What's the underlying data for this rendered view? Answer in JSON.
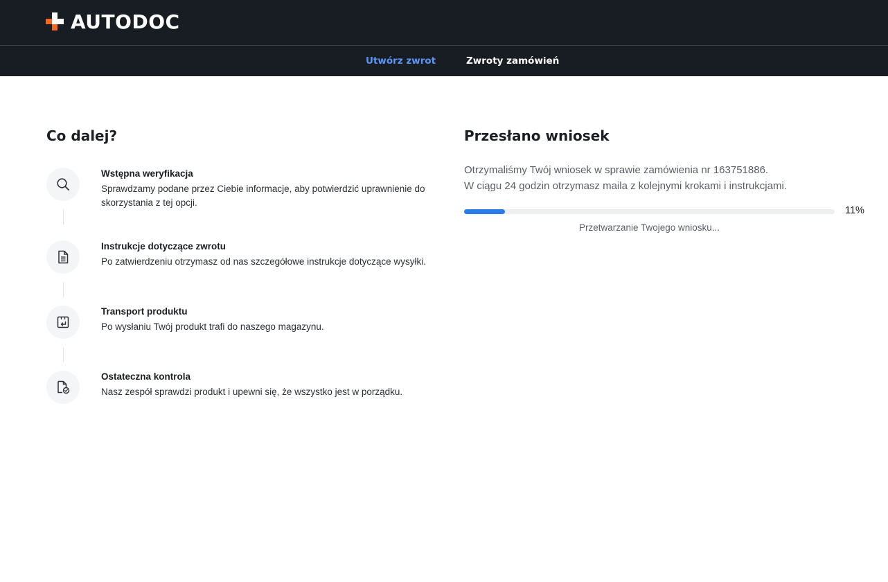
{
  "header": {
    "brand": "AUTODOC",
    "nav": [
      {
        "label": "Utwórz zwrot",
        "active": true
      },
      {
        "label": "Zwroty zamówień",
        "active": false
      }
    ]
  },
  "next_steps": {
    "title": "Co dalej?",
    "steps": [
      {
        "icon": "search-icon",
        "title": "Wstępna weryfikacja",
        "description": "Sprawdzamy podane przez Ciebie informacje, aby potwierdzić uprawnienie do skorzystania z tej opcji."
      },
      {
        "icon": "document-icon",
        "title": "Instrukcje dotyczące zwrotu",
        "description": "Po zatwierdzeniu otrzymasz od nas szczegółowe instrukcje dotyczące wysyłki."
      },
      {
        "icon": "return-box-icon",
        "title": "Transport produktu",
        "description": "Po wysłaniu Twój produkt trafi do naszego magazynu."
      },
      {
        "icon": "document-check-icon",
        "title": "Ostateczna kontrola",
        "description": "Nasz zespół sprawdzi produkt i upewni się, że wszystko jest w porządku."
      }
    ]
  },
  "submission": {
    "title": "Przesłano wniosek",
    "message_line1": "Otrzymaliśmy Twój wniosek w sprawie zamówienia nr 163751886.",
    "message_line2": "W ciągu 24 godzin otrzymasz maila z kolejnymi krokami i instrukcjami.",
    "progress_value": 11,
    "progress_label": "11%",
    "status_text": "Przetwarzanie Twojego wniosku..."
  },
  "colors": {
    "header_bg": "#171d22",
    "accent": "#f26822",
    "active_tab": "#5c95f7",
    "progress": "#2b7be8"
  }
}
